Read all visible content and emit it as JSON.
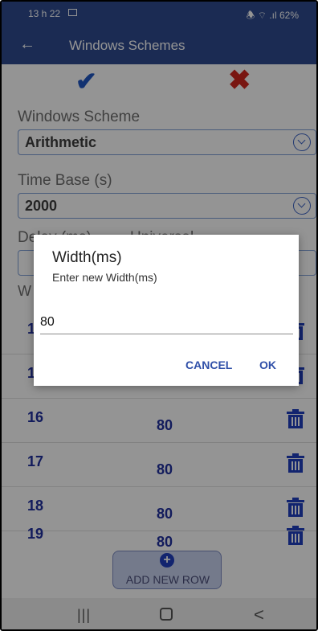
{
  "status_bar": {
    "time": "13 h 22",
    "right": "🕭 ⌔ .ıl 62%"
  },
  "app_bar": {
    "back_icon": "←",
    "title": "Windows Schemes"
  },
  "toolbar": {
    "confirm_icon": "✔",
    "cancel_icon": "✖"
  },
  "form": {
    "scheme_label": "Windows Scheme",
    "scheme_value": "Arithmetic",
    "time_base_label": "Time Base (s)",
    "time_base_value": "2000",
    "delay_label": "Delay (ms)",
    "universal_label": "Universal",
    "table_header": "W"
  },
  "rows": [
    {
      "num": "1",
      "width": ""
    },
    {
      "num": "1",
      "width": ""
    },
    {
      "num": "16",
      "width": "80"
    },
    {
      "num": "17",
      "width": "80"
    },
    {
      "num": "18",
      "width": "80"
    },
    {
      "num": "19",
      "width": "80"
    }
  ],
  "add_button": {
    "label": "ADD NEW ROW",
    "icon": "+"
  },
  "dialog": {
    "title": "Width(ms)",
    "message": "Enter new Width(ms)",
    "input_value": "80",
    "cancel_label": "CANCEL",
    "ok_label": "OK"
  },
  "nav_bar": {
    "recents_icon": "|||",
    "back_icon": "<"
  },
  "colors": {
    "primary": "#2f4b8f",
    "accent": "#1f3fbf",
    "cancel_red": "#d0261e"
  }
}
